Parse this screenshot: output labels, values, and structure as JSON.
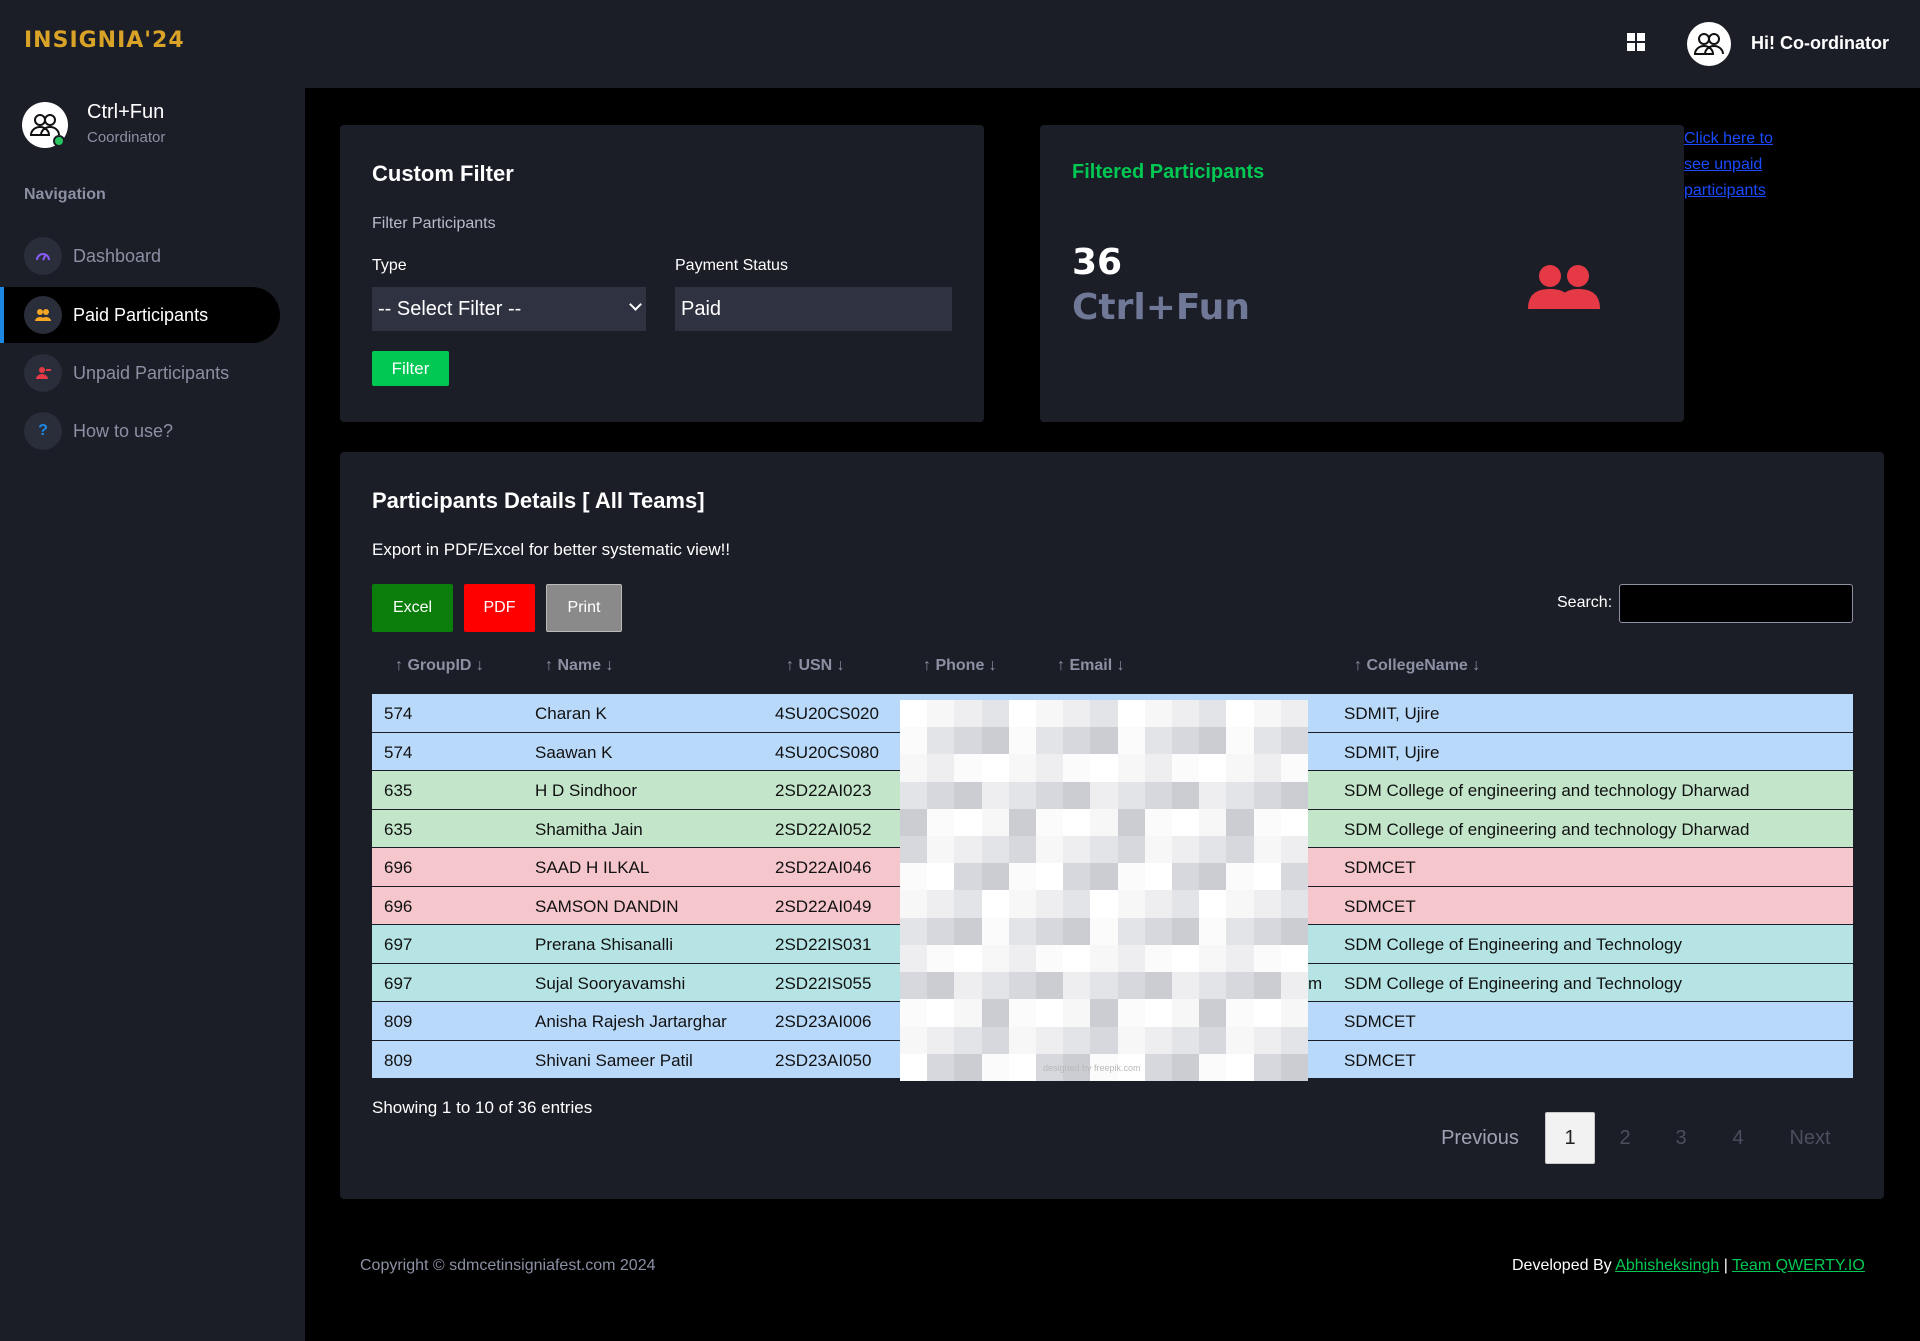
{
  "app": {
    "brand": "INSIGNIA'24",
    "greeting": "Hi! Co-ordinator"
  },
  "sidebar": {
    "user_name": "Ctrl+Fun",
    "user_role": "Coordinator",
    "nav_heading": "Navigation",
    "items": [
      {
        "label": "Dashboard",
        "icon": "gauge-icon",
        "color": "#8a5cf6"
      },
      {
        "label": "Paid Participants",
        "icon": "users-icon",
        "color": "#f5a623"
      },
      {
        "label": "Unpaid Participants",
        "icon": "user-minus-icon",
        "color": "#e53945"
      },
      {
        "label": "How to use?",
        "icon": "question-icon",
        "color": "#1e88e5"
      }
    ]
  },
  "filter": {
    "title": "Custom Filter",
    "subtitle": "Filter Participants",
    "type_label": "Type",
    "type_value": "-- Select Filter --",
    "status_label": "Payment Status",
    "status_value": "Paid",
    "button": "Filter"
  },
  "summary": {
    "title": "Filtered Participants",
    "count": "36",
    "team": "Ctrl+Fun",
    "icon": "users-icon",
    "icon_color": "#e53945"
  },
  "side_link": "Click here to see unpaid participants",
  "details": {
    "title": "Participants Details [ All Teams]",
    "export_note": "Export in PDF/Excel for better systematic view!!",
    "buttons": {
      "excel": "Excel",
      "pdf": "PDF",
      "print": "Print"
    },
    "search_label": "Search:",
    "columns": [
      "GroupID",
      "Name",
      "USN",
      "Phone",
      "Email",
      "CollegeName"
    ],
    "rows": [
      {
        "group": "574",
        "name": "Charan K",
        "usn": "4SU20CS020",
        "tail": "",
        "college": "SDMIT, Ujire",
        "bg": "#b9d9fb"
      },
      {
        "group": "574",
        "name": "Saawan K",
        "usn": "4SU20CS080",
        "tail": "",
        "college": "SDMIT, Ujire",
        "bg": "#b9d9fb"
      },
      {
        "group": "635",
        "name": "H D Sindhoor",
        "usn": "2SD22AI023",
        "tail": "",
        "college": "SDM College of engineering and technology Dharwad",
        "bg": "#c3e6cb"
      },
      {
        "group": "635",
        "name": "Shamitha Jain",
        "usn": "2SD22AI052",
        "tail": "",
        "college": "SDM College of engineering and technology Dharwad",
        "bg": "#c3e6cb"
      },
      {
        "group": "696",
        "name": "SAAD H ILKAL",
        "usn": "2SD22AI046",
        "tail": "",
        "college": "SDMCET",
        "bg": "#f5c6cb"
      },
      {
        "group": "696",
        "name": "SAMSON DANDIN",
        "usn": "2SD22AI049",
        "tail": "",
        "college": "SDMCET",
        "bg": "#f5c6cb"
      },
      {
        "group": "697",
        "name": "Prerana Shisanalli",
        "usn": "2SD22IS031",
        "tail": "",
        "college": "SDM College of Engineering and Technology",
        "bg": "#b6e4e4"
      },
      {
        "group": "697",
        "name": "Sujal Sooryavamshi",
        "usn": "2SD22IS055",
        "tail": "m",
        "college": "SDM College of Engineering and Technology",
        "bg": "#b6e4e4"
      },
      {
        "group": "809",
        "name": "Anisha Rajesh Jartarghar",
        "usn": "2SD23AI006",
        "tail": "",
        "college": "SDMCET",
        "bg": "#b9d9fb"
      },
      {
        "group": "809",
        "name": "Shivani Sameer Patil",
        "usn": "2SD23AI050",
        "tail": "",
        "college": "SDMCET",
        "bg": "#b9d9fb"
      }
    ],
    "redaction_caption": "designed by freepik.com",
    "info": "Showing 1 to 10 of 36 entries",
    "pagination": {
      "previous": "Previous",
      "pages": [
        "1",
        "2",
        "3",
        "4"
      ],
      "next": "Next",
      "current": "1"
    }
  },
  "footer": {
    "copyright": "Copyright © sdmcetinsigniafest.com 2024",
    "developed_by": "Developed By",
    "dev_name": "Abhisheksingh",
    "separator": "|",
    "team": "Team QWERTY.IO"
  }
}
